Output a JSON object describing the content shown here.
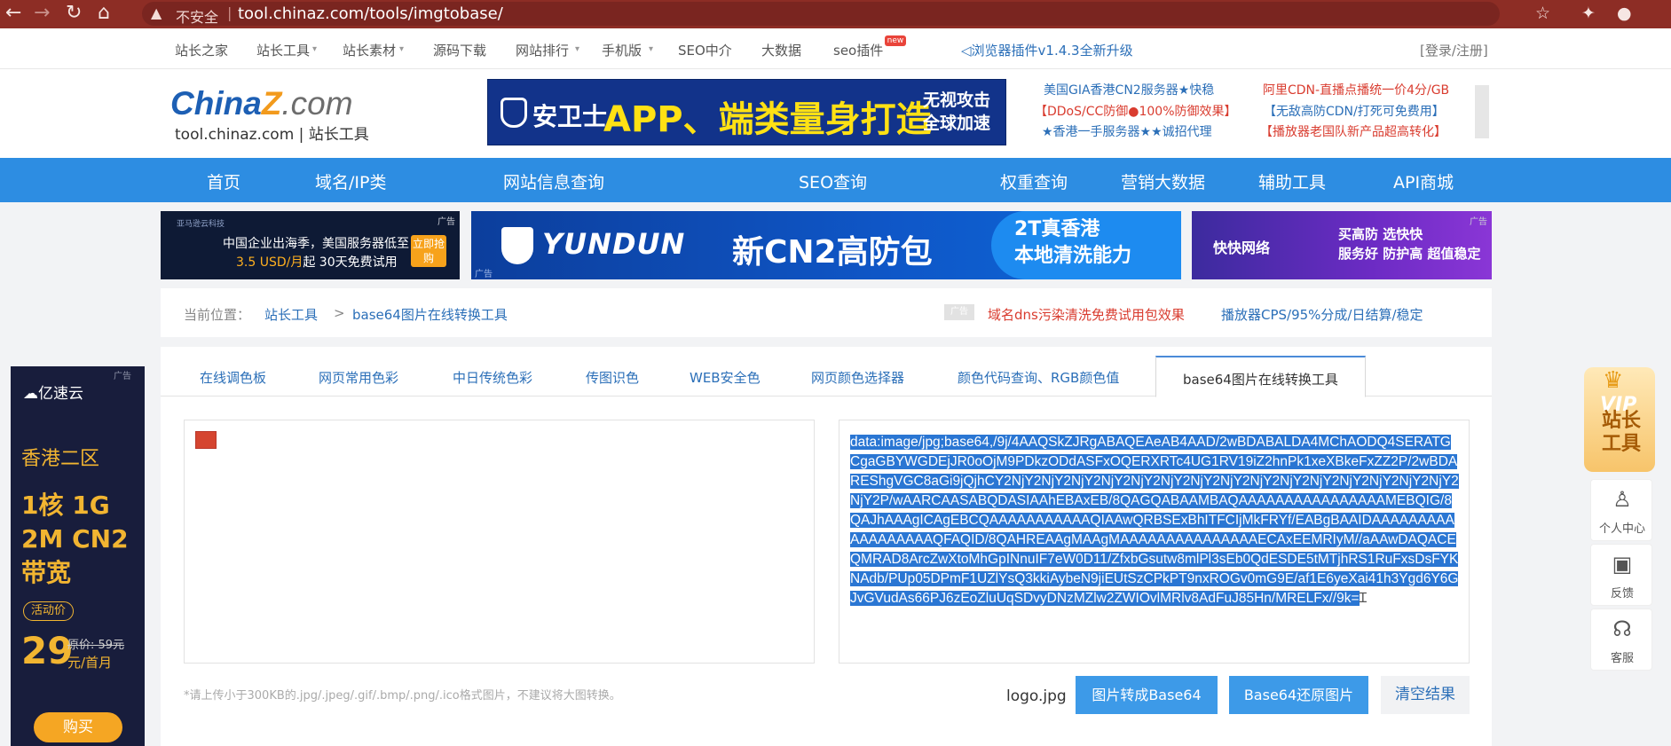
{
  "browser": {
    "back_icon": "←",
    "forward_icon": "→",
    "reload_icon": "↻",
    "home_icon": "⌂",
    "warning_icon": "▲",
    "insecure_label": "不安全",
    "url": "tool.chinaz.com/tools/imgtobase/",
    "star_icon": "☆",
    "extension_icon": "✦",
    "profile_icon": "●"
  },
  "topbar": {
    "items": [
      "站长之家",
      "站长工具",
      "站长素材",
      "源码下载",
      "网站排行",
      "手机版",
      "SEO中介",
      "大数据",
      "seo插件"
    ],
    "hot_badge": "new",
    "plugin_text": "浏览器插件v1.4.3全新升级",
    "login": "[登录/注册]"
  },
  "header": {
    "logo_china": "China",
    "logo_z": "Z",
    "logo_com": ".com",
    "logo_sub": "tool.chinaz.com | 站长工具",
    "banner_brand": "安卫士",
    "banner_slogan": "APP、端类量身打造",
    "banner_side": "无视攻击 全球加速",
    "ad_lines": [
      "美国GIA香港CN2服务器★快稳",
      "阿里CDN-直播点播统一价4分/GB",
      "【DDoS/CC防御●100%防御效果】",
      "【无敌高防CDN/打死可免费用】",
      "★香港一手服务器★★诚招代理",
      "【播放器老国队新产品超高转化】"
    ]
  },
  "mainnav": {
    "items": [
      "首页",
      "域名/IP类",
      "网站信息查询",
      "SEO查询",
      "权重查询",
      "营销大数据",
      "辅助工具",
      "API商城"
    ]
  },
  "ads": {
    "ad1_brand": "亚马逊云科技",
    "ad1_line1": "中国企业出海季，美国服务器低至",
    "ad1_price": "3.5 USD/月",
    "ad1_line2": "起 30天免费试用",
    "ad1_btn": "立即抢购",
    "ad2_brand": "YUNDUN",
    "ad2_title": "新CN2高防包",
    "ad2_side1": "2T真香港",
    "ad2_side2": "本地清洗能力",
    "ad3_brand": "快快网络",
    "ad3_line1": "买高防 选快快",
    "ad3_line2": "服务好 防护高 超值稳定",
    "ad_tag": "广告"
  },
  "breadcrumb": {
    "prefix": "当前位置：",
    "home": "站长工具",
    "sep": ">",
    "current": "base64图片在线转换工具",
    "promo_tag": "广告",
    "promo1": "域名dns污染清洗免费试用包效果",
    "promo2": "播放器CPS/95%分成/日结算/稳定"
  },
  "tabs": [
    "在线调色板",
    "网页常用色彩",
    "中日传统色彩",
    "传图识色",
    "WEB安全色",
    "网页颜色选择器",
    "颜色代码查询、RGB颜色值",
    "base64图片在线转换工具"
  ],
  "tool": {
    "base64_output": "data:image/jpg;base64,/9j/4AAQSkZJRgABAQEAeAB4AAD/2wBDABALDA4MChAODQ4SERATGCgaGBYWGDEjJR0oOjM9PDkzODdASFxOQERXRTc4UG1RV19iZ2hnPk1xeXBkeFxZZ2P/2wBDAREShgVGC8aGi9jQjhCY2NjY2NjY2NjY2NjY2NjY2NjY2NjY2NjY2NjY2NjY2NjY2NjY2NjY2NjY2NjY2NjY2P/wAARCAASABQDASIAAhEBAxEB/8QAGQABAAMBAQAAAAAAAAAAAAAAAAMEBQIG/8QAJhAAAgICAgEBCQAAAAAAAAAAAQIAAwQRBSExBhITFCIjMkFRYf/EABgBAAIDAAAAAAAAAAAAAAAAAAQFAQID/8QAHREAAgMAAgMAAAAAAAAAAAAAAAECAxEEMRIyM//aAAwDAQACEQMRAD8ArcZwXtoMhGpINnuIF7eW0D11/ZfxbGsutw8mlPl3sEb0QdESDE5tMTjhRS1RuFxsDsFYKNAdb/PUp05DPmF1UZlYsQ3kkiAybeN9jiEUtSzCPkPT9nxROGv0mG9E/af1E6yeXai41h3Ygd6Y6GJvGVudAs66PJ6zEoZluUqSDvyDNzMZlw2ZWIOvlMRlv8AdFuJ85Hn/MRELFx//9k=",
    "hint": "*请上传小于300KB的.jpg/.jpeg/.gif/.bmp/.png/.ico格式图片，不建议将大图转换。",
    "filename": "logo.jpg",
    "btn_to_base64": "图片转成Base64",
    "btn_to_image": "Base64还原图片",
    "btn_clear": "清空结果"
  },
  "sidead": {
    "logo": "亿速云",
    "tag": "广告",
    "region": "香港二区",
    "spec": "1核 1G 2M CN2带宽",
    "pill": "活动价",
    "price": "29",
    "orig": "原价: 59元",
    "per": "元/首月",
    "buy": "购买"
  },
  "rightpanel": {
    "vip": "VIP",
    "vip_title": "站长工具",
    "crown_icon": "♛",
    "user_icon": "♙",
    "user_label": "个人中心",
    "feedback_icon": "▣",
    "feedback_label": "反馈",
    "service_icon": "☊",
    "service_label": "客服"
  },
  "colors": {
    "browser_bar": "#8d2d25",
    "nav_blue": "#2d8de2",
    "button_blue": "#3d9ae8",
    "selection_blue": "#2a76d3",
    "link_blue": "#2b6fb8"
  }
}
